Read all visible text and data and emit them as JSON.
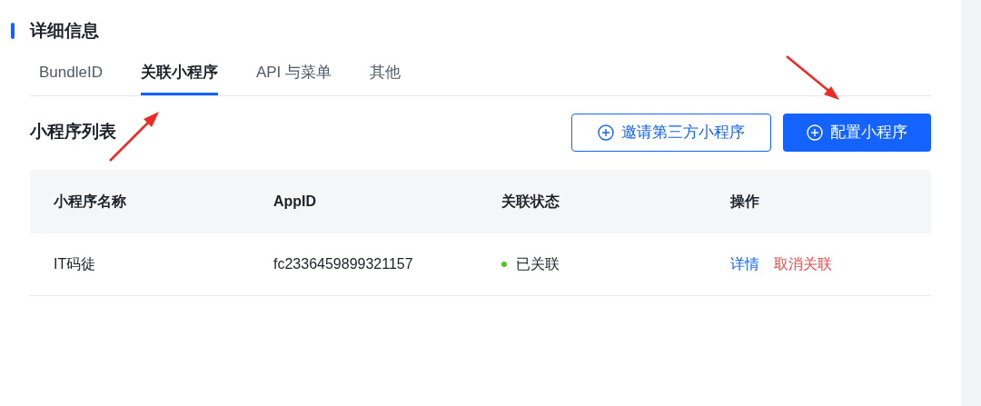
{
  "section": {
    "title": "详细信息"
  },
  "tabs": [
    {
      "label": "BundleID",
      "selected": false
    },
    {
      "label": "关联小程序",
      "selected": true
    },
    {
      "label": "API 与菜单",
      "selected": false
    },
    {
      "label": "其他",
      "selected": false
    }
  ],
  "list": {
    "title": "小程序列表",
    "buttons": [
      {
        "label": "邀请第三方小程序",
        "kind": "outline"
      },
      {
        "label": "配置小程序",
        "kind": "primary"
      }
    ]
  },
  "table": {
    "columns": [
      "小程序名称",
      "AppID",
      "关联状态",
      "操作"
    ],
    "rows": [
      {
        "name": "IT码徒",
        "appid": "fc2336459899321157",
        "status": {
          "label": "已关联",
          "color": "#52c41a"
        },
        "actions": [
          {
            "label": "详情",
            "kind": "link"
          },
          {
            "label": "取消关联",
            "kind": "danger"
          }
        ]
      }
    ]
  }
}
